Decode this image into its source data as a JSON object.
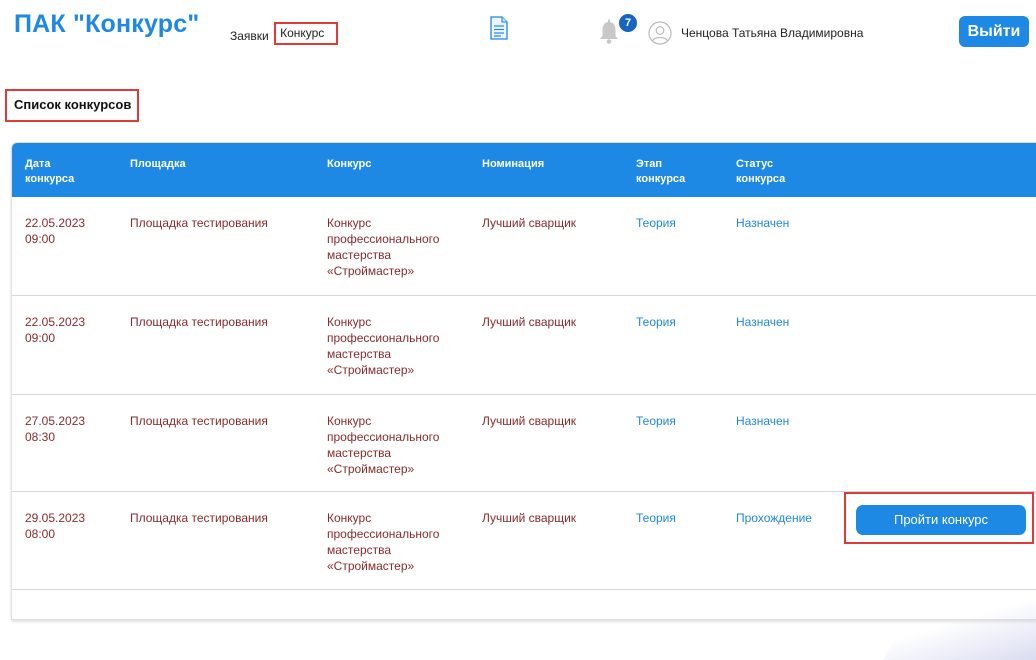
{
  "header": {
    "logo": "ПАК \"Конкурс\"",
    "nav": {
      "applications": "Заявки",
      "contest": "Конкурс"
    },
    "notifications_count": "7",
    "user_name": "Ченцова Татьяна Владимировна",
    "logout_label": "Выйти"
  },
  "page_title": "Список конкурсов",
  "table": {
    "columns": {
      "date_1": "Дата",
      "date_2": "конкурса",
      "place": "Площадка",
      "contest": "Конкурс",
      "nomination": "Номинация",
      "stage_1": "Этап",
      "stage_2": "конкурса",
      "status_1": "Статус",
      "status_2": "конкурса"
    },
    "rows": [
      {
        "date": "22.05.2023",
        "time": "09:00",
        "place": "Площадка тестирования",
        "contest": [
          "Конкурс",
          "профессионального",
          "мастерства",
          "«Строймастер»"
        ],
        "nomination": "Лучший сварщик",
        "stage": "Теория",
        "status": "Назначен"
      },
      {
        "date": "22.05.2023",
        "time": "09:00",
        "place": "Площадка тестирования",
        "contest": [
          "Конкурс",
          "профессионального",
          "мастерства",
          "«Строймастер»"
        ],
        "nomination": "Лучший сварщик",
        "stage": "Теория",
        "status": "Назначен"
      },
      {
        "date": "27.05.2023",
        "time": "08:30",
        "place": "Площадка тестирования",
        "contest": [
          "Конкурс",
          "профессионального",
          "мастерства",
          "«Строймастер»"
        ],
        "nomination": "Лучший сварщик",
        "stage": "Теория",
        "status": "Назначен"
      },
      {
        "date": "29.05.2023",
        "time": "08:00",
        "place": "Площадка тестирования",
        "contest": [
          "Конкурс",
          "профессионального",
          "мастерства",
          "«Строймастер»"
        ],
        "nomination": "Лучший сварщик",
        "stage": "Теория",
        "status": "Прохождение",
        "action_label": "Пройти конкурс"
      }
    ]
  },
  "colors": {
    "accent": "#1e88e5",
    "highlight": "#e03a3a",
    "row_text": "#8b2a2a"
  },
  "icons": {
    "document": "document-icon",
    "bell": "bell-icon",
    "avatar": "user-avatar-icon"
  }
}
